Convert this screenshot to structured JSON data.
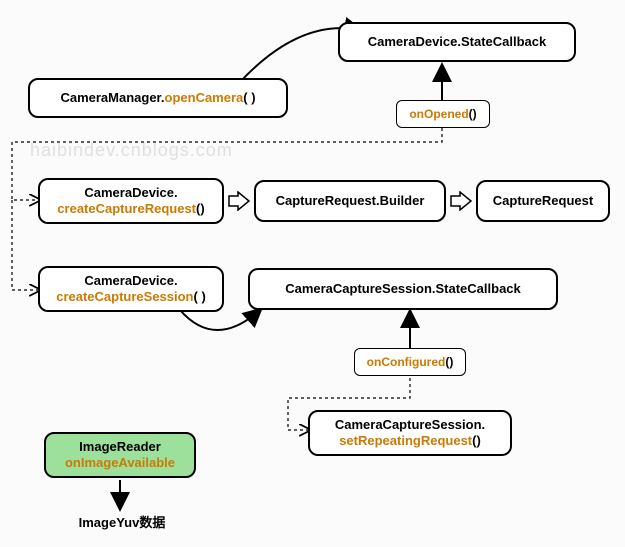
{
  "watermark": "haibindev.cnblogs.com",
  "nodes": {
    "openCamera": {
      "prefix": "CameraManager.",
      "method": "openCamera",
      "suffix": "( )"
    },
    "stateCallback": {
      "text": "CameraDevice.StateCallback"
    },
    "onOpened": {
      "method": "onOpened",
      "suffix": "()"
    },
    "createCaptureRequest": {
      "prefix": "CameraDevice.",
      "method": "createCaptureRequest",
      "suffix": "()"
    },
    "captureRequestBuilder": {
      "text": "CaptureRequest.Builder"
    },
    "captureRequest": {
      "text": "CaptureRequest"
    },
    "createCaptureSession": {
      "prefix": "CameraDevice.",
      "method": "createCaptureSession",
      "suffix": "( )"
    },
    "sessionStateCallback": {
      "text": "CameraCaptureSession.StateCallback"
    },
    "onConfigured": {
      "method": "onConfigured",
      "suffix": "()"
    },
    "setRepeatingRequest": {
      "prefix": "CameraCaptureSession.",
      "method": "setRepeatingRequest",
      "suffix": "()"
    },
    "imageReader": {
      "prefix": "ImageReader",
      "method": "onImageAvailable"
    },
    "imageYuv": {
      "text": "ImageYuv数据"
    }
  }
}
